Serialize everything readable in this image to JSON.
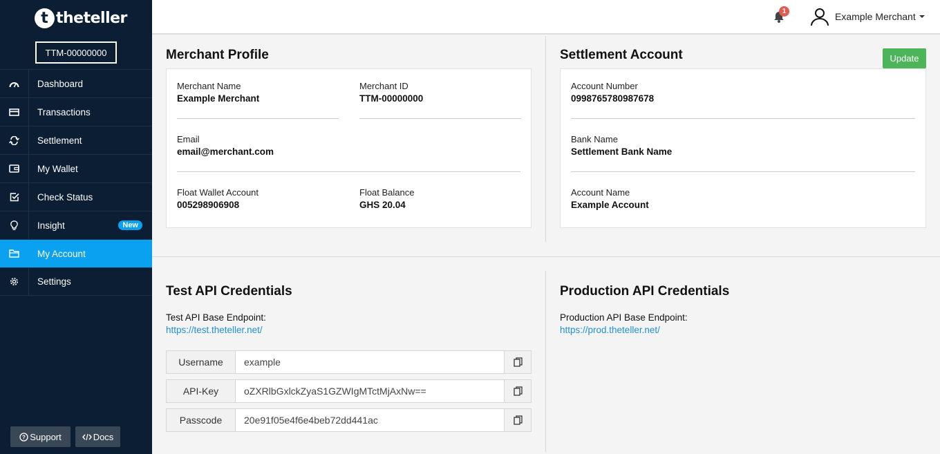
{
  "sidebar": {
    "logo_text": "theteller",
    "logo_letter": "t",
    "merchant_id_box": "TTM-00000000",
    "items": [
      {
        "label": "Dashboard",
        "icon": "gauge-icon"
      },
      {
        "label": "Transactions",
        "icon": "card-icon"
      },
      {
        "label": "Settlement",
        "icon": "exchange-icon"
      },
      {
        "label": "My Wallet",
        "icon": "wallet-icon"
      },
      {
        "label": "Check Status",
        "icon": "check-square-icon"
      },
      {
        "label": "Insight",
        "icon": "lightbulb-icon",
        "badge": "New"
      },
      {
        "label": "My Account",
        "icon": "folder-icon",
        "active": true
      },
      {
        "label": "Settings",
        "icon": "gear-icon"
      }
    ],
    "support_label": "Support",
    "docs_label": "Docs"
  },
  "header": {
    "notification_count": "1",
    "user_name": "Example Merchant"
  },
  "merchant_profile": {
    "title": "Merchant Profile",
    "merchant_name_label": "Merchant Name",
    "merchant_name": "Example Merchant",
    "merchant_id_label": "Merchant ID",
    "merchant_id": "TTM-00000000",
    "email_label": "Email",
    "email": "email@merchant.com",
    "float_wallet_label": "Float Wallet Account",
    "float_wallet": "005298906908",
    "float_balance_label": "Float Balance",
    "float_balance": "GHS 20.04"
  },
  "settlement_account": {
    "title": "Settlement Account",
    "update_label": "Update",
    "account_number_label": "Account Number",
    "account_number": "0998765780987678",
    "bank_name_label": "Bank Name",
    "bank_name": "Settlement Bank Name",
    "account_name_label": "Account Name",
    "account_name": "Example Account"
  },
  "test_api": {
    "title": "Test API Credentials",
    "endpoint_label": "Test API Base Endpoint:",
    "endpoint_url": "https://test.theteller.net/",
    "credentials": [
      {
        "label": "Username",
        "value": "example"
      },
      {
        "label": "API-Key",
        "value": "oZXRlbGxlckZyaS1GZWIgMTctMjAxNw=="
      },
      {
        "label": "Passcode",
        "value": "20e91f05e4f6e4beb72dd441ac"
      }
    ]
  },
  "production_api": {
    "title": "Production API Credentials",
    "endpoint_label": "Production API Base Endpoint:",
    "endpoint_url": "https://prod.theteller.net/"
  },
  "colors": {
    "sidebar_bg": "#0c1e33",
    "accent": "#0aa2f0",
    "update_green": "#4cb55a",
    "link_blue": "#1f8fd6"
  }
}
